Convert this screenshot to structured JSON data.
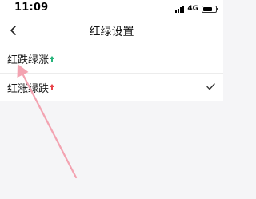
{
  "status_bar": {
    "time": "11:09",
    "network": "4G",
    "battery_level": 0.75
  },
  "nav": {
    "title": "红绿设置",
    "back_icon": "chevron-left-icon"
  },
  "options": [
    {
      "label": "红跌绿涨",
      "trend_icon": "green-up-arrow-icon",
      "selected": false
    },
    {
      "label": "红涨绿跌",
      "trend_icon": "red-up-arrow-icon",
      "selected": true
    }
  ],
  "colors": {
    "green": "#26b37a",
    "red": "#e8444a",
    "annotation_arrow": "#f08ca0",
    "background": "#f5f5f7"
  }
}
